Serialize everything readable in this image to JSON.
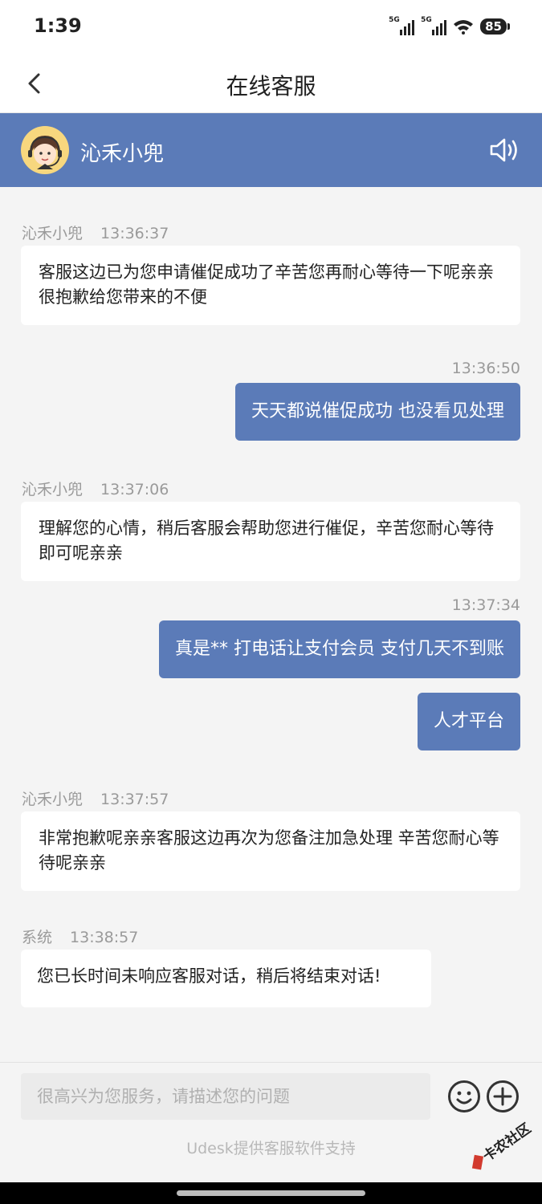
{
  "status_bar": {
    "time": "1:39",
    "signal_1_label": "5G",
    "signal_2_label": "5G",
    "battery": "85"
  },
  "nav": {
    "title": "在线客服",
    "back_icon": "chevron-left-icon"
  },
  "agent": {
    "name": "沁禾小兜",
    "avatar_icon": "agent-avatar-headset-icon",
    "speaker_icon": "speaker-icon"
  },
  "messages": [
    {
      "side": "left",
      "sender": "沁禾小兜",
      "time": "13:36:37",
      "text": "客服这边已为您申请催促成功了辛苦您再耐心等待一下呢亲亲 很抱歉给您带来的不便"
    },
    {
      "side": "right",
      "time": "13:36:50",
      "text": "天天都说催促成功 也没看见处理"
    },
    {
      "side": "left",
      "sender": "沁禾小兜",
      "time": "13:37:06",
      "text": "理解您的心情，稍后客服会帮助您进行催促，辛苦您耐心等待即可呢亲亲"
    },
    {
      "side": "right",
      "time": "13:37:34",
      "text": "真是** 打电话让支付会员 支付几天不到账"
    },
    {
      "side": "right",
      "time": "",
      "text": "人才平台"
    },
    {
      "side": "left",
      "sender": "沁禾小兜",
      "time": "13:37:57",
      "text": "非常抱歉呢亲亲客服这边再次为您备注加急处理 辛苦您耐心等待呢亲亲"
    },
    {
      "side": "left",
      "sender": "系统",
      "time": "13:38:57",
      "text": "您已长时间未响应客服对话，稍后将结束对话!"
    }
  ],
  "input": {
    "placeholder": "很高兴为您服务，请描述您的问题",
    "value": "",
    "emoji_icon": "emoji-icon",
    "plus_icon": "plus-icon"
  },
  "footer": {
    "powered_by": "Udesk提供客服软件支持",
    "watermark_text": "卡农社区"
  },
  "colors": {
    "accent": "#5b7bb8",
    "background": "#f4f4f4",
    "bubble_left": "#ffffff",
    "meta_text": "#9a9a9a"
  }
}
